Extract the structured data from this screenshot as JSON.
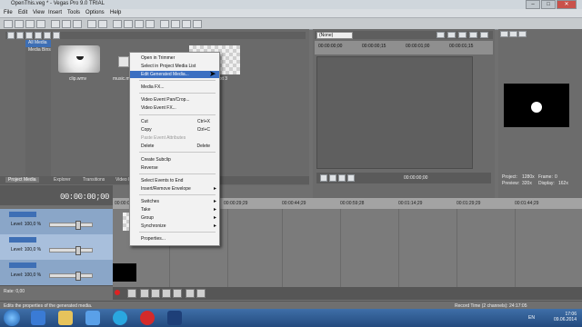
{
  "window": {
    "title": "OpenThis.veg * - Vegas Pro 9.0 TRIAL",
    "min": "–",
    "max": "□",
    "close": "✕"
  },
  "menu": [
    "File",
    "Edit",
    "View",
    "Insert",
    "Tools",
    "Options",
    "Help"
  ],
  "tree": [
    "All Media",
    "Media Bins"
  ],
  "media": {
    "clip1": "clip.wmv",
    "clip2": "music.m",
    "clip3": "xt 3"
  },
  "tabs": [
    "Project Media",
    "Explorer",
    "Transitions",
    "Video FX"
  ],
  "preview": {
    "dropdown": "(None)",
    "ruler": [
      "00:00:00;00",
      "00:00:00;15",
      "00:00:01;00",
      "00:00:01;15"
    ],
    "timecode": "00:00:00;00"
  },
  "videoInfo": {
    "project_label": "Project:",
    "project": "1280x",
    "preview_label": "Preview:",
    "preview": "320x",
    "frame_label": "Frame:",
    "frame": "0",
    "display_label": "Display:",
    "display": "162x"
  },
  "timeline": {
    "timecode": "00:00:00;00",
    "ruler": [
      "00:00:00;00",
      "00:00:29;29",
      "00:00:44;29",
      "00:00:59;28",
      "00:01:14;29",
      "00:01:29;29",
      "00:01:44;29"
    ],
    "tracks": [
      {
        "level": "Level: 100,0 %"
      },
      {
        "level": "Level: 100,0 %"
      },
      {
        "level": "Level: 100,0 %"
      }
    ],
    "rate": "Rate: 0,00"
  },
  "context_menu": {
    "items": [
      {
        "label": "Open in Trimmer",
        "shortcut": "",
        "submenu": false,
        "disabled": false,
        "highlight": false
      },
      {
        "label": "Select in Project Media List",
        "shortcut": "",
        "submenu": false,
        "disabled": false,
        "highlight": false
      },
      {
        "label": "Edit Generated Media...",
        "shortcut": "",
        "submenu": false,
        "disabled": false,
        "highlight": true
      },
      {
        "label": "Media FX...",
        "shortcut": "",
        "submenu": false,
        "disabled": false,
        "highlight": false
      },
      {
        "label": "Video Event Pan/Crop...",
        "shortcut": "",
        "submenu": false,
        "disabled": false,
        "highlight": false
      },
      {
        "label": "Video Event FX...",
        "shortcut": "",
        "submenu": false,
        "disabled": false,
        "highlight": false
      },
      {
        "label": "Cut",
        "shortcut": "Ctrl+X",
        "submenu": false,
        "disabled": false,
        "highlight": false
      },
      {
        "label": "Copy",
        "shortcut": "Ctrl+C",
        "submenu": false,
        "disabled": false,
        "highlight": false
      },
      {
        "label": "Paste Event Attributes",
        "shortcut": "",
        "submenu": false,
        "disabled": true,
        "highlight": false
      },
      {
        "label": "Delete",
        "shortcut": "Delete",
        "submenu": false,
        "disabled": false,
        "highlight": false
      },
      {
        "label": "Create Subclip",
        "shortcut": "",
        "submenu": false,
        "disabled": false,
        "highlight": false
      },
      {
        "label": "Reverse",
        "shortcut": "",
        "submenu": false,
        "disabled": false,
        "highlight": false
      },
      {
        "label": "Select Events to End",
        "shortcut": "",
        "submenu": false,
        "disabled": false,
        "highlight": false
      },
      {
        "label": "Insert/Remove Envelope",
        "shortcut": "",
        "submenu": true,
        "disabled": false,
        "highlight": false
      },
      {
        "label": "Switches",
        "shortcut": "",
        "submenu": true,
        "disabled": false,
        "highlight": false
      },
      {
        "label": "Take",
        "shortcut": "",
        "submenu": true,
        "disabled": false,
        "highlight": false
      },
      {
        "label": "Group",
        "shortcut": "",
        "submenu": true,
        "disabled": false,
        "highlight": false
      },
      {
        "label": "Synchronize",
        "shortcut": "",
        "submenu": true,
        "disabled": false,
        "highlight": false
      },
      {
        "label": "Properties...",
        "shortcut": "",
        "submenu": false,
        "disabled": false,
        "highlight": false
      }
    ]
  },
  "status": {
    "message": "Edits the properties of the generated media.",
    "record_time": "Record Time (2 channels): 24:17:05"
  },
  "taskbar": {
    "time": "17:06",
    "date": "09.06.2014",
    "lang": "EN"
  }
}
